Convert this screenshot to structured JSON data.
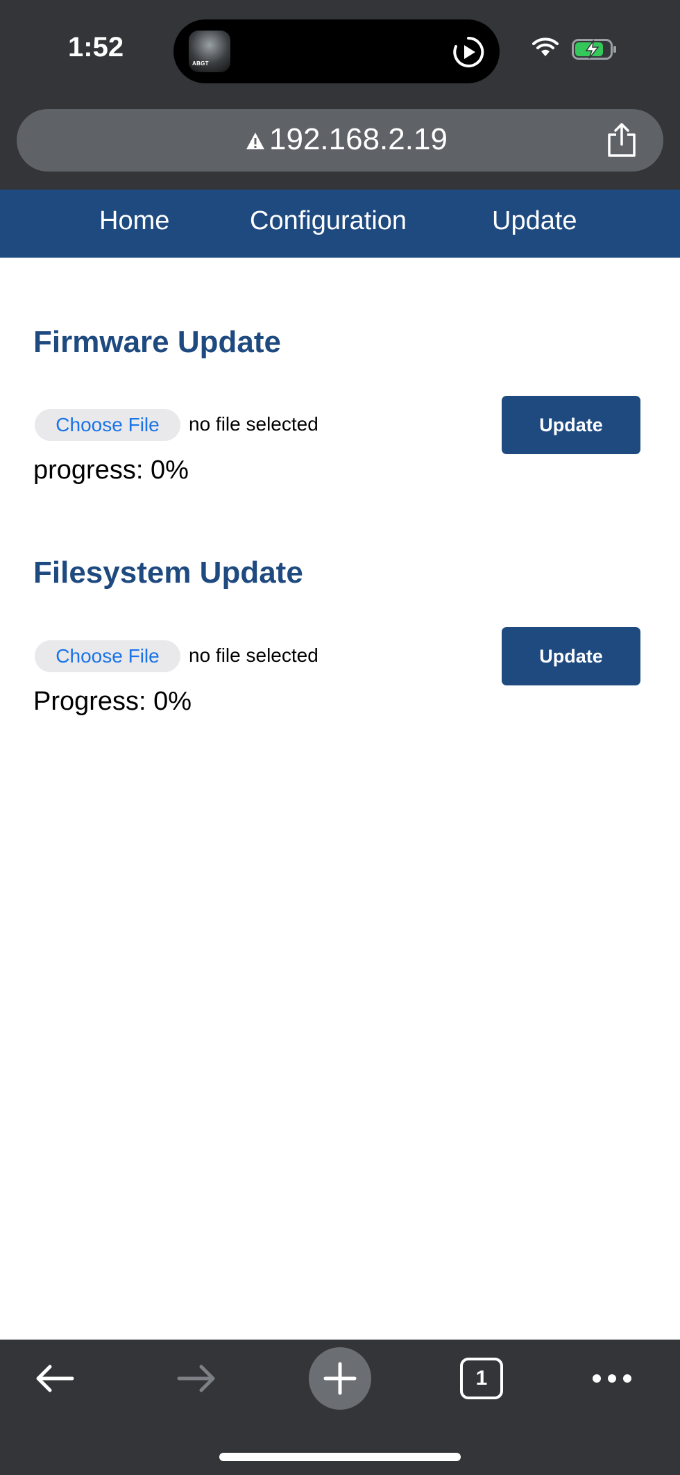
{
  "status_bar": {
    "time": "1:52",
    "now_playing_art_text": "ABGT",
    "icons": [
      "play-icon",
      "wifi-icon",
      "battery-charging-icon"
    ]
  },
  "browser": {
    "url": "192.168.2.19",
    "url_icon": "warning-icon",
    "share_icon": "share-icon",
    "tab_count": "1",
    "toolbar_icons": [
      "back-arrow-icon",
      "forward-arrow-icon",
      "new-tab-plus-icon",
      "tabs-icon",
      "more-icon"
    ]
  },
  "nav": {
    "items": [
      {
        "label": "Home"
      },
      {
        "label": "Configuration"
      },
      {
        "label": "Update"
      }
    ]
  },
  "firmware": {
    "title": "Firmware Update",
    "choose_label": "Choose File",
    "file_status": "no file selected",
    "button_label": "Update",
    "progress_text": "progress: 0%",
    "progress_value": 0
  },
  "filesystem": {
    "title": "Filesystem Update",
    "choose_label": "Choose File",
    "file_status": "no file selected",
    "button_label": "Update",
    "progress_text": "Progress: 0%",
    "progress_value": 0
  },
  "colors": {
    "accent": "#1e4a80",
    "chrome": "#333539",
    "link_blue": "#1a73e8"
  }
}
